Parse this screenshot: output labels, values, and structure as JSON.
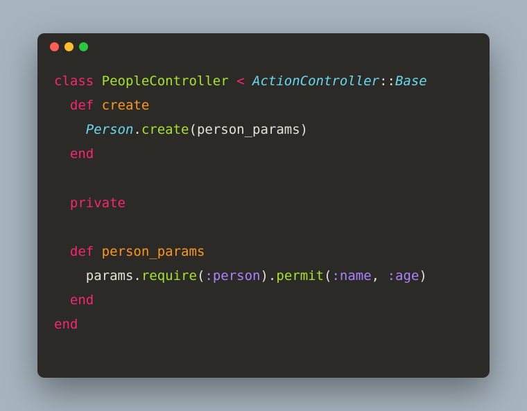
{
  "code": {
    "line1": {
      "class_kw": "class",
      "class_name": "PeopleController",
      "lt": "<",
      "base": "ActionController",
      "scope": "::",
      "base2": "Base"
    },
    "line2": {
      "def_kw": "def",
      "method_name": "create"
    },
    "line3": {
      "receiver": "Person",
      "dot": ".",
      "method": "create",
      "lparen": "(",
      "arg": "person_params",
      "rparen": ")"
    },
    "line4": {
      "end_kw": "end"
    },
    "line6": {
      "private_kw": "private"
    },
    "line8": {
      "def_kw": "def",
      "method_name": "person_params"
    },
    "line9": {
      "receiver": "params",
      "dot1": ".",
      "method1": "require",
      "lparen1": "(",
      "sym1": ":person",
      "rparen1": ")",
      "dot2": ".",
      "method2": "permit",
      "lparen2": "(",
      "sym2": ":name",
      "comma": ", ",
      "sym3": ":age",
      "rparen2": ")"
    },
    "line10": {
      "end_kw": "end"
    },
    "line11": {
      "end_kw": "end"
    }
  }
}
